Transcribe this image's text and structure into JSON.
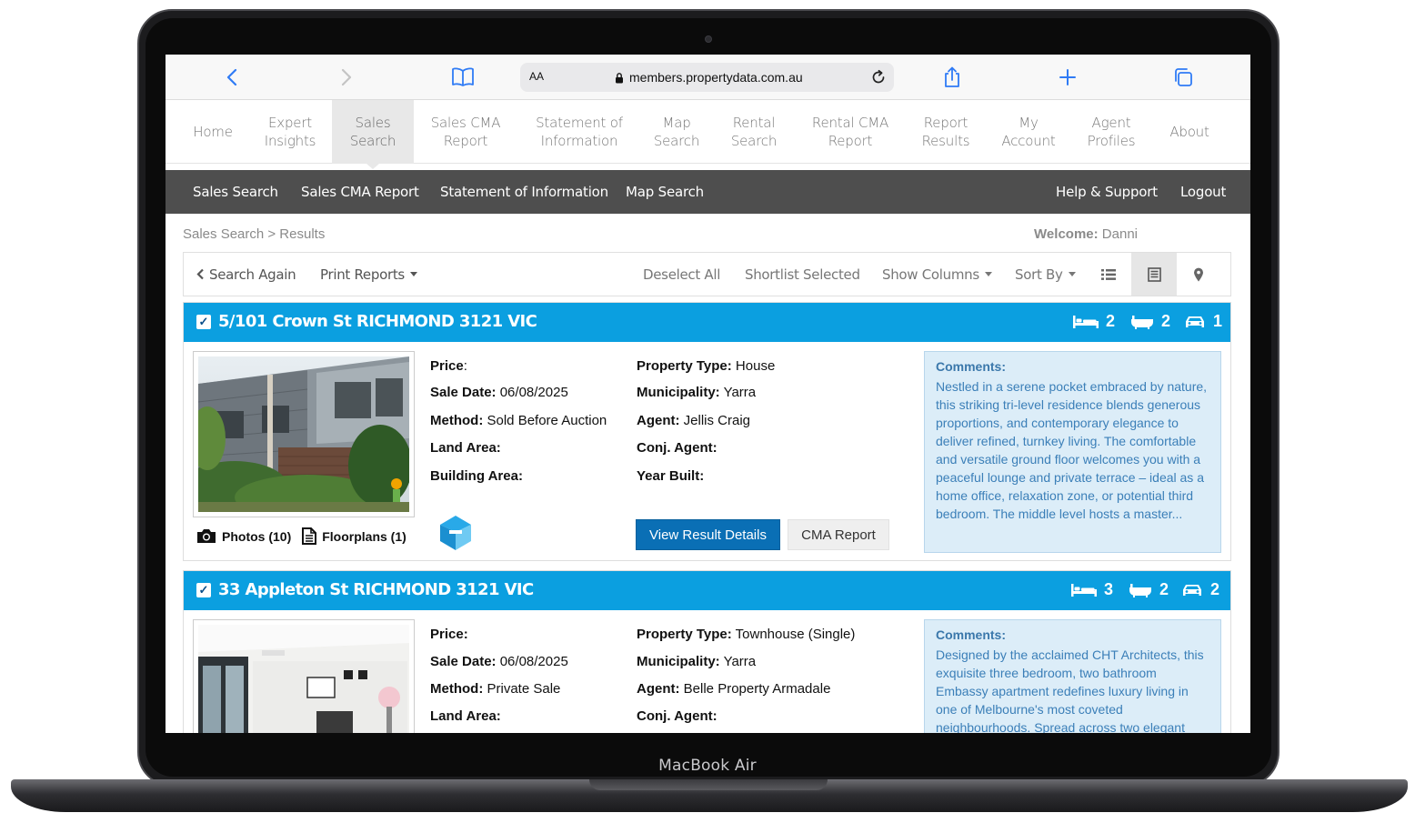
{
  "device": {
    "label": "MacBook Air"
  },
  "browser": {
    "text_size_label": "AA",
    "url": "members.propertydata.com.au",
    "icons": [
      "back-icon",
      "forward-icon",
      "bookmarks-icon",
      "lock-icon",
      "reload-icon",
      "share-icon",
      "new-tab-icon",
      "tabs-icon"
    ],
    "accent_color": "#2f7bf5"
  },
  "main_nav": {
    "items": [
      {
        "label": "Home"
      },
      {
        "label": "Expert\nInsights"
      },
      {
        "label": "Sales\nSearch",
        "active": true
      },
      {
        "label": "Sales CMA\nReport"
      },
      {
        "label": "Statement of\nInformation"
      },
      {
        "label": "Map\nSearch"
      },
      {
        "label": "Rental\nSearch"
      },
      {
        "label": "Rental CMA\nReport"
      },
      {
        "label": "Report\nResults"
      },
      {
        "label": "My\nAccount"
      },
      {
        "label": "Agent\nProfiles"
      },
      {
        "label": "About"
      }
    ]
  },
  "sub_nav": {
    "left": [
      "Sales Search",
      "Sales CMA Report",
      "Statement of Information",
      "Map Search"
    ],
    "right": [
      "Help & Support",
      "Logout"
    ]
  },
  "breadcrumb": "Sales Search > Results",
  "welcome": {
    "label": "Welcome:",
    "name": "Danni"
  },
  "toolbar": {
    "search_again": "Search Again",
    "print_reports": "Print Reports",
    "deselect_all": "Deselect All",
    "shortlist_selected": "Shortlist Selected",
    "show_columns": "Show Columns",
    "sort_by": "Sort By",
    "view_icons": [
      "list-view-icon",
      "card-view-icon",
      "map-pin-icon"
    ],
    "active_view": "card-view-icon"
  },
  "listings": [
    {
      "address": "5/101 Crown St RICHMOND 3121 VIC",
      "bedrooms": "2",
      "bathrooms": "2",
      "cars": "1",
      "photos_label": "Photos (10)",
      "floorplans_label": "Floorplans (1)",
      "labels": {
        "price": "Price",
        "sale_date": "Sale Date:",
        "method": "Method:",
        "land_area": "Land Area:",
        "building_area": "Building Area:",
        "property_type": "Property Type:",
        "municipality": "Municipality:",
        "agent": "Agent:",
        "conj_agent": "Conj. Agent:",
        "year_built": "Year Built:"
      },
      "price_suffix": ":",
      "sale_date": "06/08/2025",
      "method": "Sold Before Auction",
      "property_type": "House",
      "municipality": "Yarra",
      "agent": "Jellis Craig",
      "view_button": "View Result Details",
      "cma_button": "CMA Report",
      "comments_title": "Comments:",
      "comments": "Nestled in a serene pocket embraced by nature, this striking tri-level residence blends generous proportions, and contemporary elegance to deliver refined, turnkey living. The comfortable and versatile ground floor welcomes you with a peaceful lounge and private terrace – ideal as a home office, relaxation zone, or potential third bedroom. The middle level hosts a master..."
    },
    {
      "address": "33 Appleton St RICHMOND 3121 VIC",
      "bedrooms": "3",
      "bathrooms": "2",
      "cars": "2",
      "labels": {
        "price": "Price:",
        "sale_date": "Sale Date:",
        "method": "Method:",
        "land_area": "Land Area:",
        "property_type": "Property Type:",
        "municipality": "Municipality:",
        "agent": "Agent:",
        "conj_agent": "Conj. Agent:"
      },
      "sale_date": "06/08/2025",
      "method": "Private Sale",
      "property_type": "Townhouse (Single)",
      "municipality": "Yarra",
      "agent": "Belle Property Armadale",
      "comments_title": "Comments:",
      "comments": "Designed by the acclaimed CHT Architects, this exquisite three bedroom, two bathroom Embassy apartment redefines luxury living in one of Melbourne's most coveted neighbourhoods. Spread across two elegant"
    }
  ],
  "colors": {
    "header_blue": "#0b9fe0",
    "button_blue": "#0a6fb5",
    "subnav_grey": "#4e4e4e",
    "comments_bg": "#dcedf8"
  }
}
